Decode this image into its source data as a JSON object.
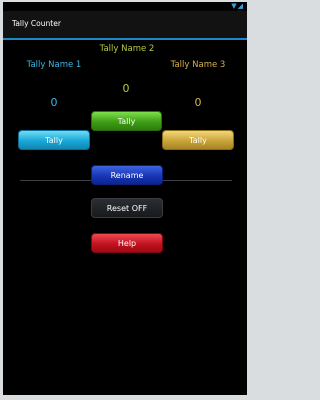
{
  "app": {
    "title": "Tally Counter"
  },
  "status": {
    "icons": "▼◢"
  },
  "tallies": [
    {
      "name": "Tally Name 1",
      "count": "0",
      "button": "Tally",
      "color": "#3cb6e3"
    },
    {
      "name": "Tally Name 2",
      "count": "0",
      "button": "Tally",
      "color": "#b7c945"
    },
    {
      "name": "Tally Name 3",
      "count": "0",
      "button": "Tally",
      "color": "#d9b24c"
    }
  ],
  "actions": {
    "rename": "Rename",
    "reset": "Reset OFF",
    "help": "Help"
  }
}
